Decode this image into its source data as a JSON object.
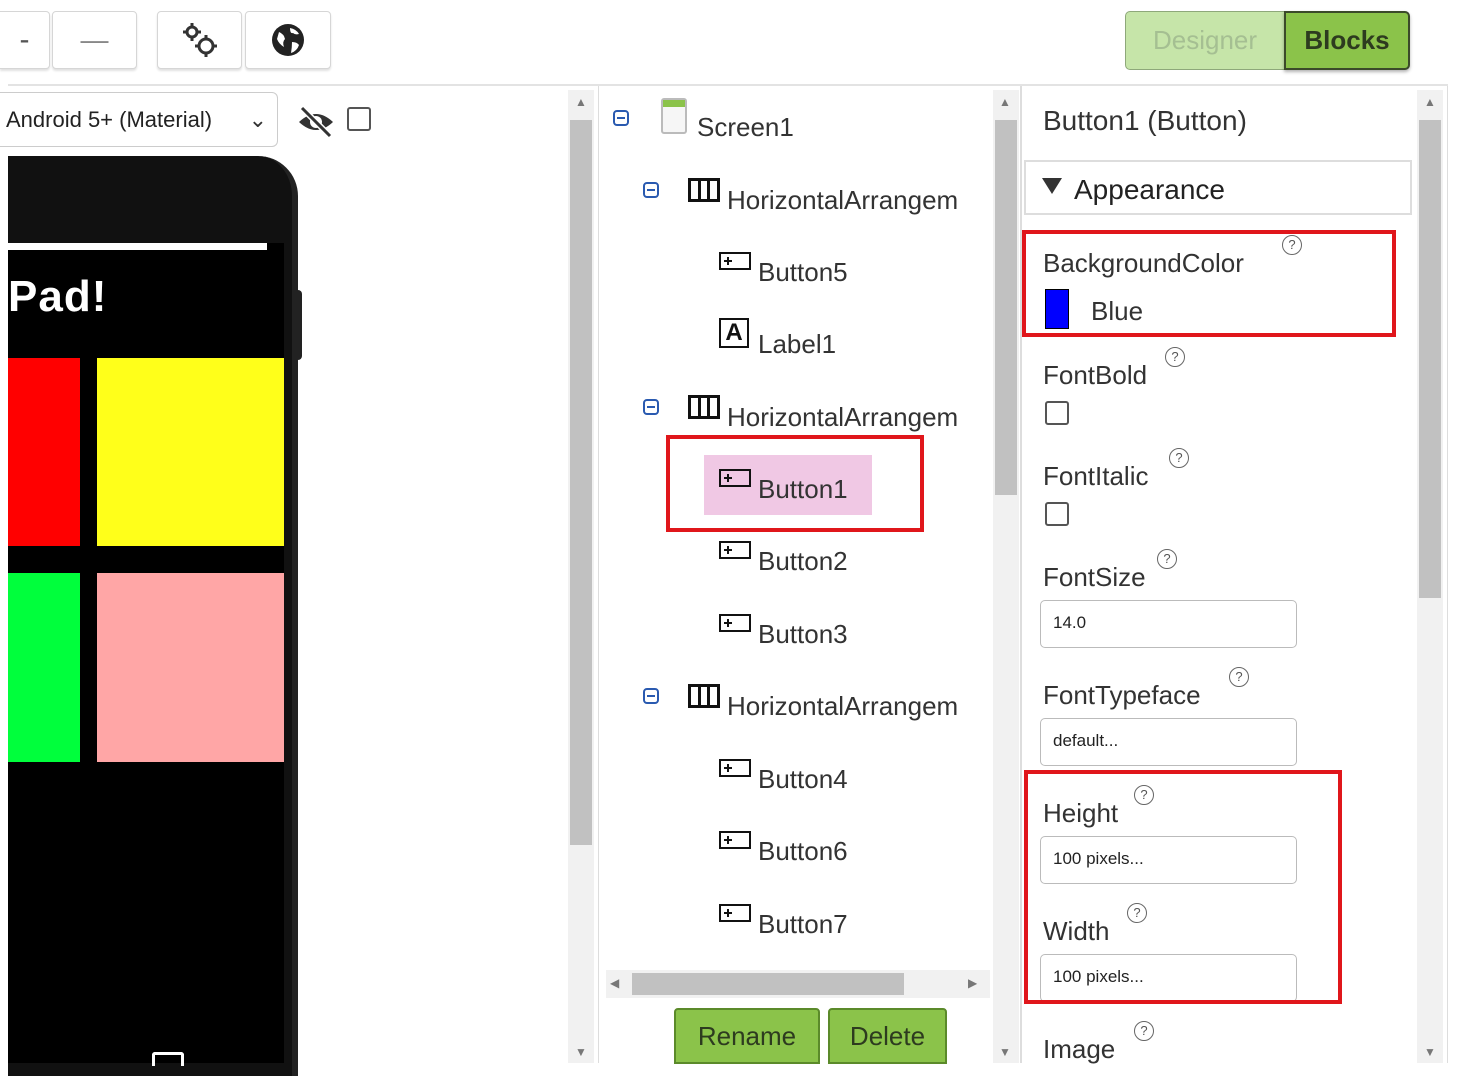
{
  "toolbar": {
    "partial_left_label": "-",
    "zoom_out_label": "—",
    "settings_icon": "gears-icon",
    "globe_icon": "globe-icon",
    "designer_label": "Designer",
    "blocks_label": "Blocks"
  },
  "viewer": {
    "device_select_value": "Android 5+ (Material)",
    "app_title_partial": "Pad!",
    "colors": {
      "red": "#ff0000",
      "yellow": "#ffff1a",
      "green": "#00ff3c",
      "pink": "#ffa6a6"
    }
  },
  "components": {
    "screen": "Screen1",
    "groups": [
      {
        "label": "HorizontalArrangem",
        "children": [
          {
            "label": "Button5",
            "icon": "button-icon"
          },
          {
            "label": "Label1",
            "icon": "label-icon"
          }
        ]
      },
      {
        "label": "HorizontalArrangem",
        "children": [
          {
            "label": "Button1",
            "icon": "button-icon",
            "selected": true
          },
          {
            "label": "Button2",
            "icon": "button-icon"
          },
          {
            "label": "Button3",
            "icon": "button-icon"
          }
        ]
      },
      {
        "label": "HorizontalArrangem",
        "children": [
          {
            "label": "Button4",
            "icon": "button-icon"
          },
          {
            "label": "Button6",
            "icon": "button-icon"
          },
          {
            "label": "Button7",
            "icon": "button-icon"
          }
        ]
      }
    ],
    "rename_label": "Rename",
    "delete_label": "Delete"
  },
  "properties": {
    "title": "Button1 (Button)",
    "section": "Appearance",
    "background_color": {
      "label": "BackgroundColor",
      "value": "Blue",
      "swatch": "#0000ff"
    },
    "font_bold": {
      "label": "FontBold",
      "checked": false
    },
    "font_italic": {
      "label": "FontItalic",
      "checked": false
    },
    "font_size": {
      "label": "FontSize",
      "value": "14.0"
    },
    "font_typeface": {
      "label": "FontTypeface",
      "value": "default..."
    },
    "height": {
      "label": "Height",
      "value": "100 pixels..."
    },
    "width": {
      "label": "Width",
      "value": "100 pixels..."
    },
    "image": {
      "label": "Image"
    },
    "help_symbol": "?"
  },
  "annotation_color": "#e0161b"
}
